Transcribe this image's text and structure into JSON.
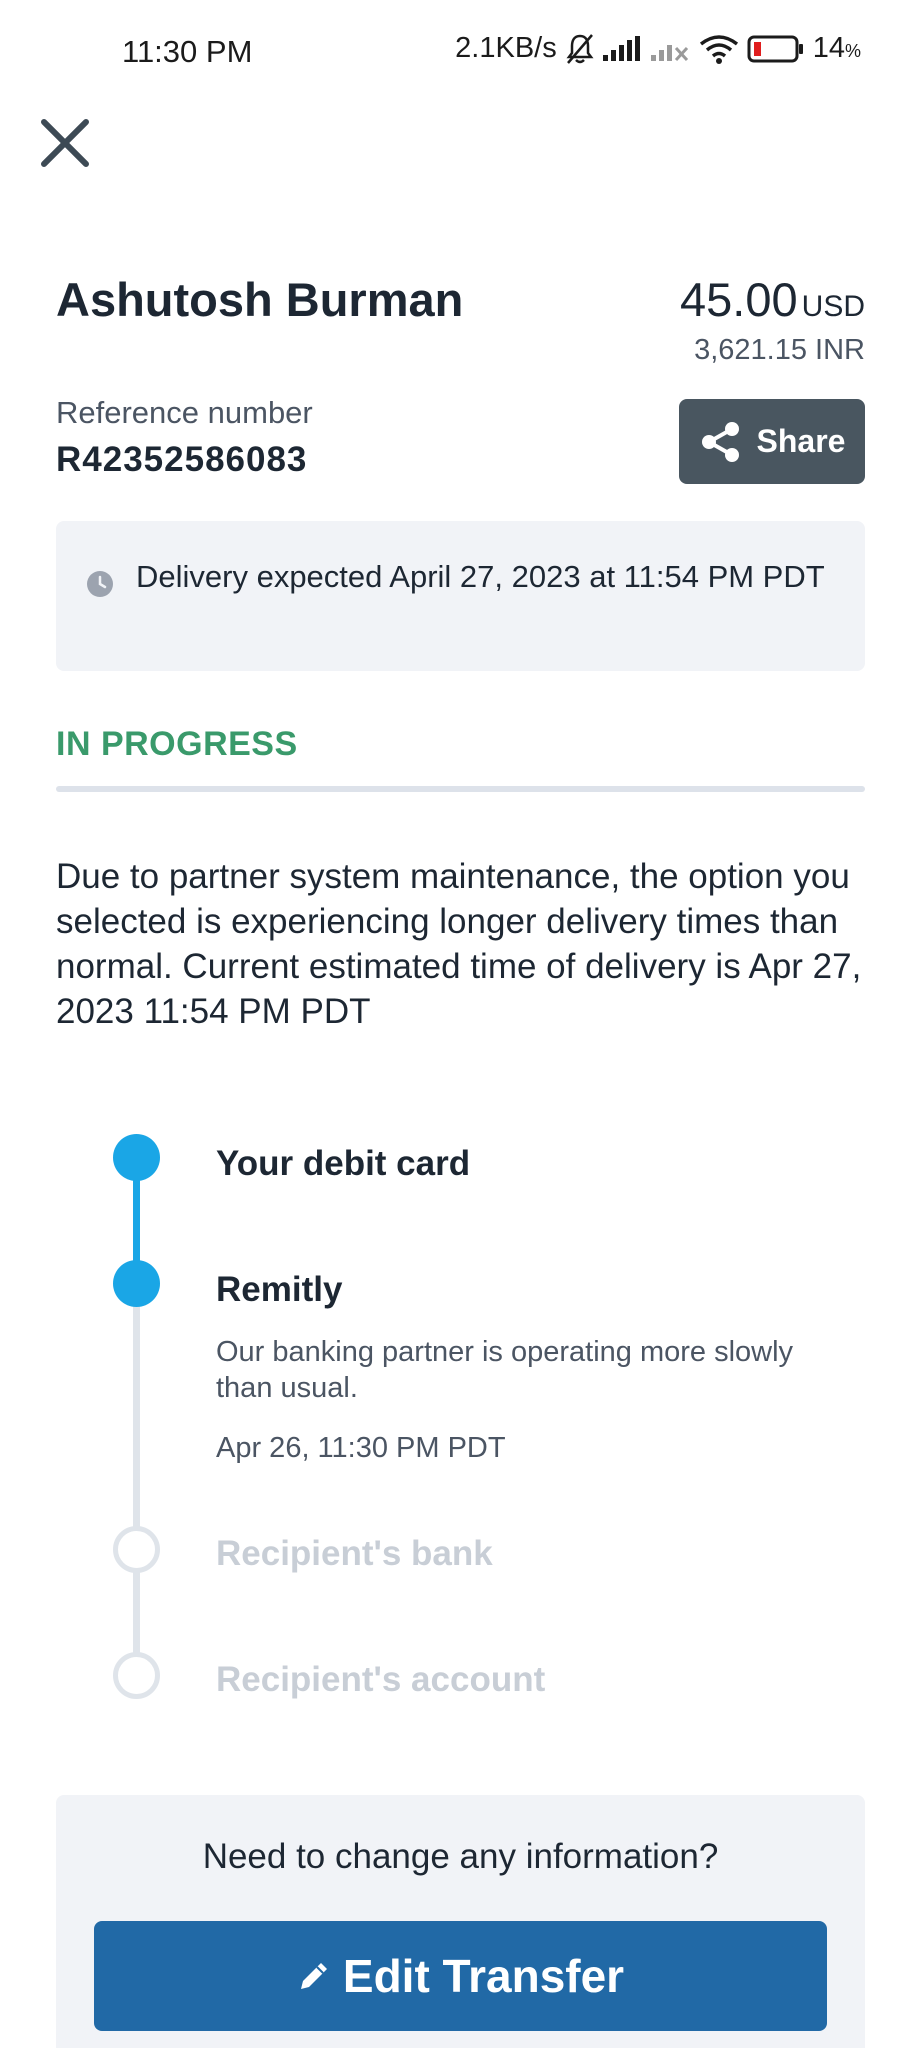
{
  "status_bar": {
    "time": "11:30 PM",
    "network_speed": "2.1KB/s",
    "battery_percent": "14",
    "battery_unit": "%",
    "icons": [
      "bell-muted-icon",
      "signal-icon",
      "signal-no-service-icon",
      "wifi-icon",
      "battery-icon"
    ]
  },
  "header": {
    "close_icon": "close-icon",
    "recipient_name": "Ashutosh Burman",
    "amount": "45.00",
    "amount_currency": "USD",
    "converted_amount": "3,621.15 INR"
  },
  "reference": {
    "label": "Reference number",
    "value": "R42352586083"
  },
  "share_button": {
    "label": "Share",
    "icon": "share-icon"
  },
  "delivery": {
    "icon": "clock-icon",
    "text": "Delivery expected April 27, 2023 at 11:54 PM PDT"
  },
  "status": {
    "label": "IN PROGRESS",
    "color": "#3a9a6b"
  },
  "notice": "Due to partner system maintenance, the option you selected is experiencing longer delivery times than normal. Current estimated time of delivery is Apr 27, 2023 11:54 PM PDT",
  "timeline": [
    {
      "title": "Your debit card",
      "state": "done"
    },
    {
      "title": "Remitly",
      "state": "done",
      "message": "Our banking partner is operating more slowly than usual.",
      "timestamp": "Apr 26, 11:30 PM PDT"
    },
    {
      "title": "Recipient's bank",
      "state": "todo"
    },
    {
      "title": "Recipient's account",
      "state": "todo"
    }
  ],
  "change_card": {
    "question": "Need to change any information?",
    "button_label": "Edit Transfer",
    "button_icon": "pencil-icon"
  },
  "colors": {
    "accent": "#1aa6e6",
    "primary_button": "#2169a6",
    "share_button": "#495660"
  }
}
